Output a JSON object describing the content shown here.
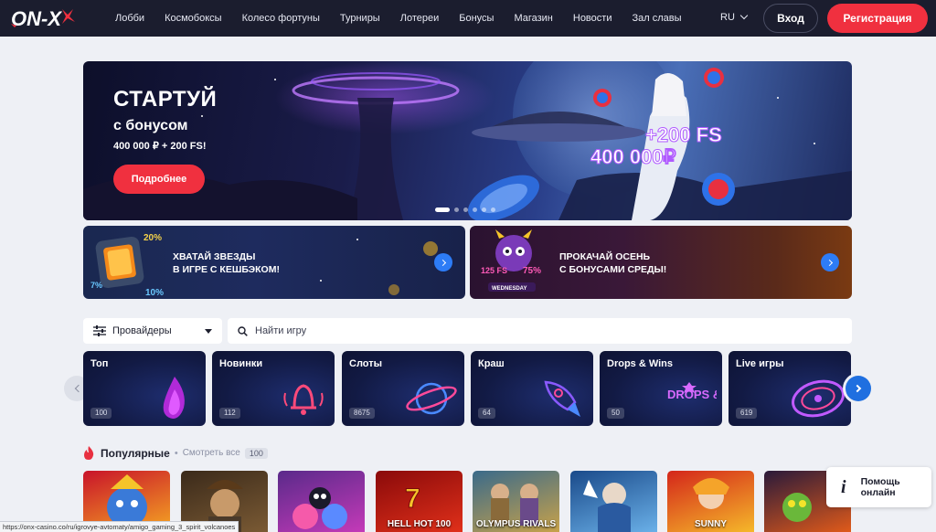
{
  "brand": {
    "logo_text": "ON-X"
  },
  "nav": {
    "items": [
      "Лобби",
      "Космобоксы",
      "Колесо фортуны",
      "Турниры",
      "Лотереи",
      "Бонусы",
      "Магазин",
      "Новости",
      "Зал славы"
    ]
  },
  "header": {
    "language": "RU",
    "login_label": "Вход",
    "register_label": "Регистрация"
  },
  "hero": {
    "title": "СТАРТУЙ",
    "subtitle": "с бонусом",
    "bonus": "400 000 ₽ + 200 FS!",
    "button_label": "Подробнее",
    "art_fs": "+200 FS",
    "art_amount": "400 000₽",
    "slides_count": 6,
    "active_slide": 1
  },
  "promos": [
    {
      "line1": "ХВАТАЙ ЗВЕЗДЫ",
      "line2": "В ИГРЕ С КЕШБЭКОМ!",
      "art_top": "20%",
      "art_left": "7%",
      "art_bottom": "10%"
    },
    {
      "line1": "ПРОКАЧАЙ ОСЕНЬ",
      "line2": "С БОНУСАМИ СРЕДЫ!",
      "art_top": "125 FS",
      "art_right": "75%",
      "art_bottom": "WEDNESDAY"
    }
  ],
  "filters": {
    "providers_label": "Провайдеры",
    "search_placeholder": "Найти игру"
  },
  "categories": [
    {
      "label": "Топ",
      "count": "100",
      "icon": "flame-icon"
    },
    {
      "label": "Новинки",
      "count": "112",
      "icon": "bell-icon"
    },
    {
      "label": "Слоты",
      "count": "8675",
      "icon": "planet-icon"
    },
    {
      "label": "Краш",
      "count": "64",
      "icon": "rocket-icon"
    },
    {
      "label": "Drops & Wins",
      "count": "50",
      "icon": "drops-wins-icon",
      "art_text": "DROPS & WINS"
    },
    {
      "label": "Live игры",
      "count": "619",
      "icon": "roulette-icon"
    }
  ],
  "popular": {
    "title": "Популярные",
    "see_all": "Смотреть все",
    "count": "100"
  },
  "games": [
    {
      "label": "",
      "color1": "#c8132a",
      "color2": "#f5a623"
    },
    {
      "label": "",
      "color1": "#3b2a1a",
      "color2": "#7a5a34"
    },
    {
      "label": "",
      "color1": "#5a2a8a",
      "color2": "#c43ab8"
    },
    {
      "label": "HELL HOT 100",
      "color1": "#8a0a0a",
      "color2": "#e0301a"
    },
    {
      "label": "OLYMPUS RIVALS",
      "color1": "#3a6a8a",
      "color2": "#c8a24a"
    },
    {
      "label": "",
      "color1": "#1a4a8a",
      "color2": "#6ab0e8"
    },
    {
      "label": "SUNNY",
      "color1": "#d4261a",
      "color2": "#f5b82a"
    },
    {
      "label": "",
      "color1": "#2a1a3a",
      "color2": "#e05a1a"
    }
  ],
  "help": {
    "line1": "Помощь",
    "line2": "онлайн"
  },
  "status_url": "https://onx-casino.co/ru/igrovye-avtomaty/amigo_gaming_3_spirit_volcanoes",
  "colors": {
    "header_bg": "#1b1d2e",
    "accent_red": "#f0303f",
    "accent_blue": "#2d7cf6",
    "page_bg": "#eef0f5"
  }
}
